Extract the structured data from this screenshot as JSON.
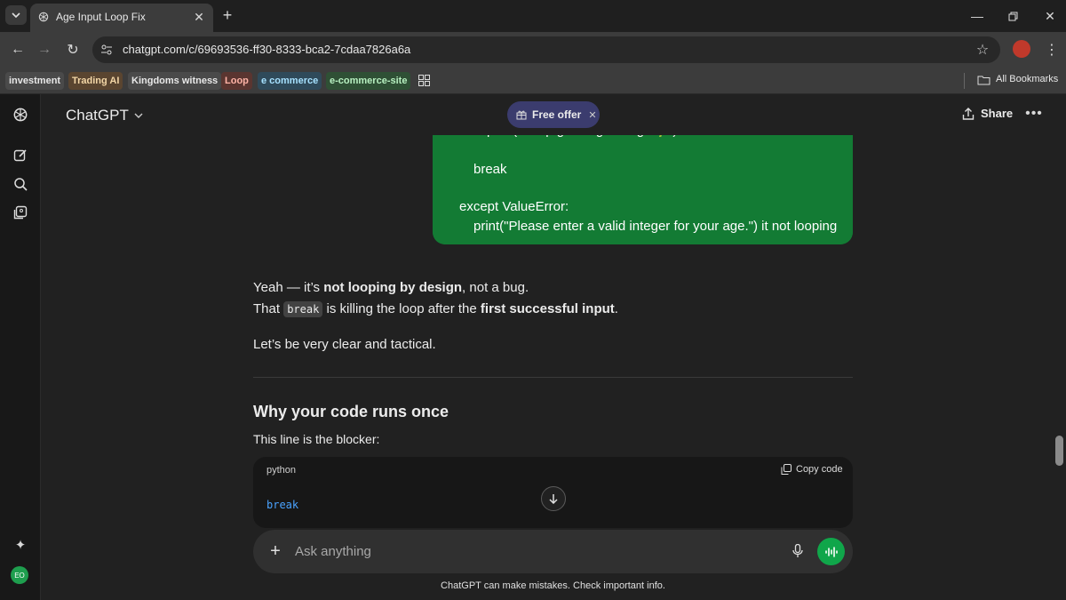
{
  "browser": {
    "tab_title": "Age Input Loop Fix",
    "url": "chatgpt.com/c/69693536-ff30-8333-bca2-7cdaa7826a6a",
    "bookmarks": [
      {
        "label": "investment",
        "color": "#e8e8e8",
        "bg": "#4a4a4a"
      },
      {
        "label": "Trading AI",
        "color": "#f3d6a6",
        "bg": "#5a4530"
      },
      {
        "label": "Kingdoms witness",
        "color": "#e8e8e8",
        "bg": "#4a4a4a"
      },
      {
        "label": "Loop",
        "color": "#ffb3a6",
        "bg": "#5a3530"
      },
      {
        "label": "e commerce",
        "color": "#a6e1ff",
        "bg": "#2f4a5a"
      },
      {
        "label": "e-commerce-site",
        "color": "#b7f0c0",
        "bg": "#2f5035"
      }
    ],
    "all_bookmarks_label": "All Bookmarks"
  },
  "header": {
    "model_label": "ChatGPT",
    "free_offer_label": "Free offer",
    "share_label": "Share"
  },
  "user_message": {
    "lines": [
      "print(\"Keep growing strong! 🌱\")",
      "break",
      "except ValueError:",
      "print(\"Please enter a valid integer for your age.\") it not looping"
    ]
  },
  "assistant": {
    "p1_a": "Yeah — it’s ",
    "p1_b": "not looping by design",
    "p1_c": ", not a bug.",
    "p2_a": "That ",
    "p2_code": "break",
    "p2_b": " is killing the loop after the ",
    "p2_c": "first successful input",
    "p2_d": ".",
    "p3": "Let’s be very clear and tactical.",
    "heading": "Why your code runs once",
    "p4": "This line is the blocker:",
    "code_lang": "python",
    "copy_label": "Copy code",
    "code": "break"
  },
  "composer": {
    "placeholder": "Ask anything"
  },
  "footer_note": "ChatGPT can make mistakes. Check important info.",
  "user_avatar_initials": "EO",
  "colors": {
    "user_bubble": "#137b34",
    "accent_green": "#10a64a",
    "code_blue": "#4aa3ff"
  }
}
